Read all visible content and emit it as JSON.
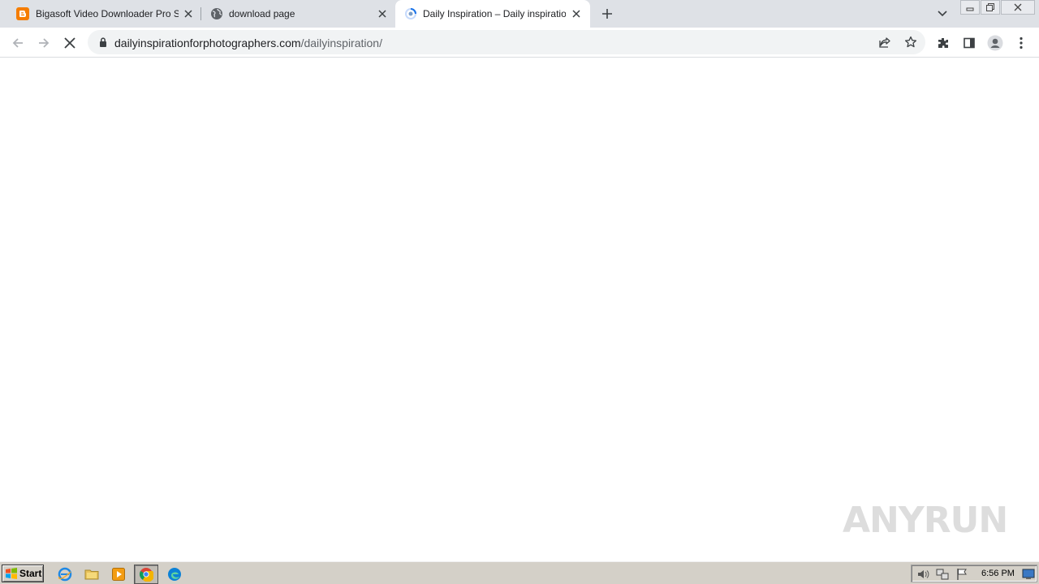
{
  "browser": {
    "tabs": [
      {
        "title": "Bigasoft Video Downloader Pro Serial",
        "icon": "blogger-icon",
        "active": false
      },
      {
        "title": "download page",
        "icon": "globe-icon",
        "active": false
      },
      {
        "title": "Daily Inspiration – Daily inspiration",
        "icon": "loading-icon",
        "active": true
      }
    ],
    "address": {
      "domain": "dailyinspirationforphotographers.com",
      "path": "/dailyinspiration/"
    }
  },
  "watermark": {
    "left": "ANY",
    "right": "RUN"
  },
  "taskbar": {
    "start_label": "Start",
    "clock": "6:56 PM"
  },
  "colors": {
    "tabstrip": "#dee1e6",
    "omnibox": "#f1f3f4",
    "taskbar": "#d4d0c8",
    "blogger": "#f57d00"
  }
}
